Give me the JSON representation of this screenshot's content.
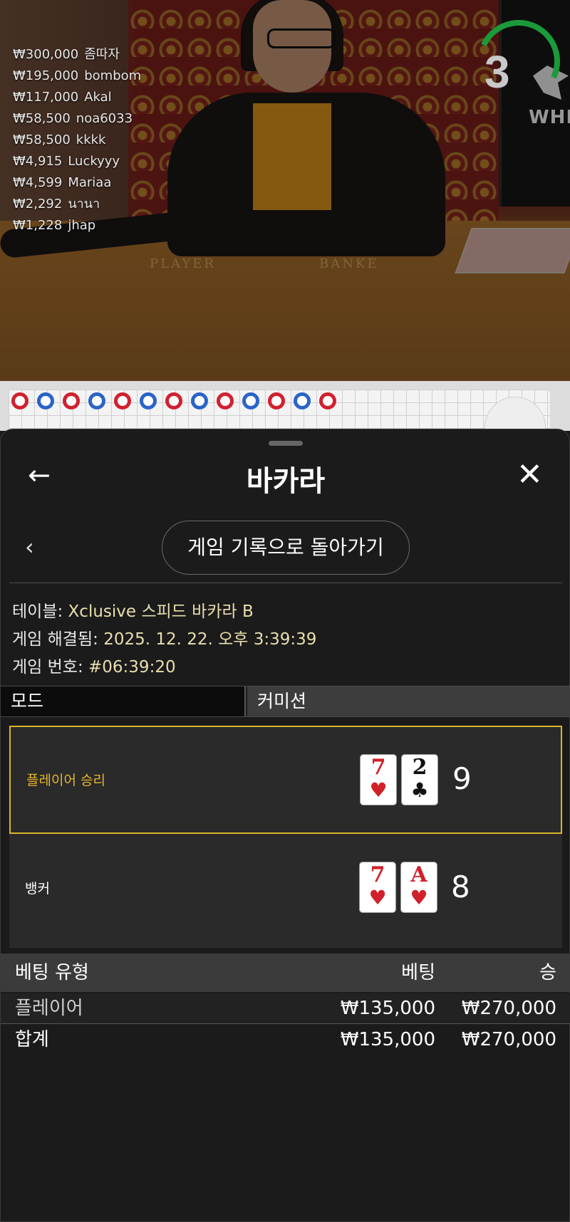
{
  "video": {
    "winners": [
      {
        "amount": "₩300,000",
        "name": "좀따자"
      },
      {
        "amount": "₩195,000",
        "name": "bombom"
      },
      {
        "amount": "₩117,000",
        "name": "Akal"
      },
      {
        "amount": "₩58,500",
        "name": "noa6033"
      },
      {
        "amount": "₩58,500",
        "name": "kkkk"
      },
      {
        "amount": "₩4,915",
        "name": "Luckyyy"
      },
      {
        "amount": "₩4,599",
        "name": "Mariaa"
      },
      {
        "amount": "₩2,292",
        "name": "นานา"
      },
      {
        "amount": "₩1,228",
        "name": "jhap"
      }
    ],
    "timer": "3",
    "table_labels": {
      "player": "PLAYER",
      "banker": "BANKE"
    },
    "monitor_text": "WHITA"
  },
  "sheet": {
    "back_icon": "←",
    "title": "바카라",
    "close_icon": "✕",
    "chevron": "‹",
    "back_to_history": "게임 기록으로 돌아가기",
    "info": {
      "table_label": "테이블:",
      "table_value": "Xclusive 스피드 바카라 B",
      "resolved_label": "게임 해결됨:",
      "resolved_value": "2025. 12. 22. 오후 3:39:39",
      "number_label": "게임 번호:",
      "number_value": "#06:39:20"
    },
    "mode_label": "모드",
    "mode_value": "커미션",
    "results": [
      {
        "label": "플레이어 승리",
        "winner": true,
        "label_color": "#e5b52a",
        "cards": [
          {
            "rank": "7",
            "suit": "♥",
            "color": "red"
          },
          {
            "rank": "2",
            "suit": "♣",
            "color": "black"
          }
        ],
        "score": "9"
      },
      {
        "label": "뱅커",
        "winner": false,
        "label_color": "#ffffff",
        "cards": [
          {
            "rank": "7",
            "suit": "♥",
            "color": "red"
          },
          {
            "rank": "A",
            "suit": "♥",
            "color": "red"
          }
        ],
        "score": "8"
      }
    ],
    "bets_header": {
      "type": "베팅 유형",
      "bet": "베팅",
      "win": "승"
    },
    "bets": [
      {
        "type": "플레이어",
        "bet": "₩135,000",
        "win": "₩270,000"
      }
    ],
    "total": {
      "type": "합계",
      "bet": "₩135,000",
      "win": "₩270,000"
    }
  },
  "colors": {
    "accent": "#e5b52a",
    "player": "#2b64c8",
    "banker": "#d0212f",
    "timer": "#1a9a3a"
  }
}
